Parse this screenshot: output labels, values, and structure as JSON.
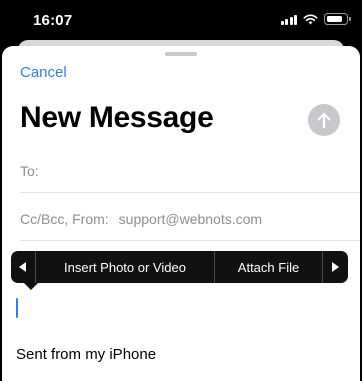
{
  "status_bar": {
    "time": "16:07",
    "signal_bars": 4,
    "battery_level": 0.85
  },
  "compose": {
    "cancel_label": "Cancel",
    "title": "New Message",
    "send_icon": "arrow-up-circle-icon"
  },
  "fields": {
    "to_label": "To:",
    "to_value": "",
    "cc_label": "Cc/Bcc, From:",
    "cc_value": "support@webnots.com"
  },
  "edit_menu": {
    "items": [
      "Insert Photo or Video",
      "Attach File"
    ],
    "left_arrow": "◀",
    "right_arrow": "▶"
  },
  "body": {
    "signature": "Sent from my iPhone"
  },
  "colors": {
    "accent": "#2f7cf6",
    "send_disabled": "#c7c7cc",
    "menu_bg": "#111111"
  }
}
